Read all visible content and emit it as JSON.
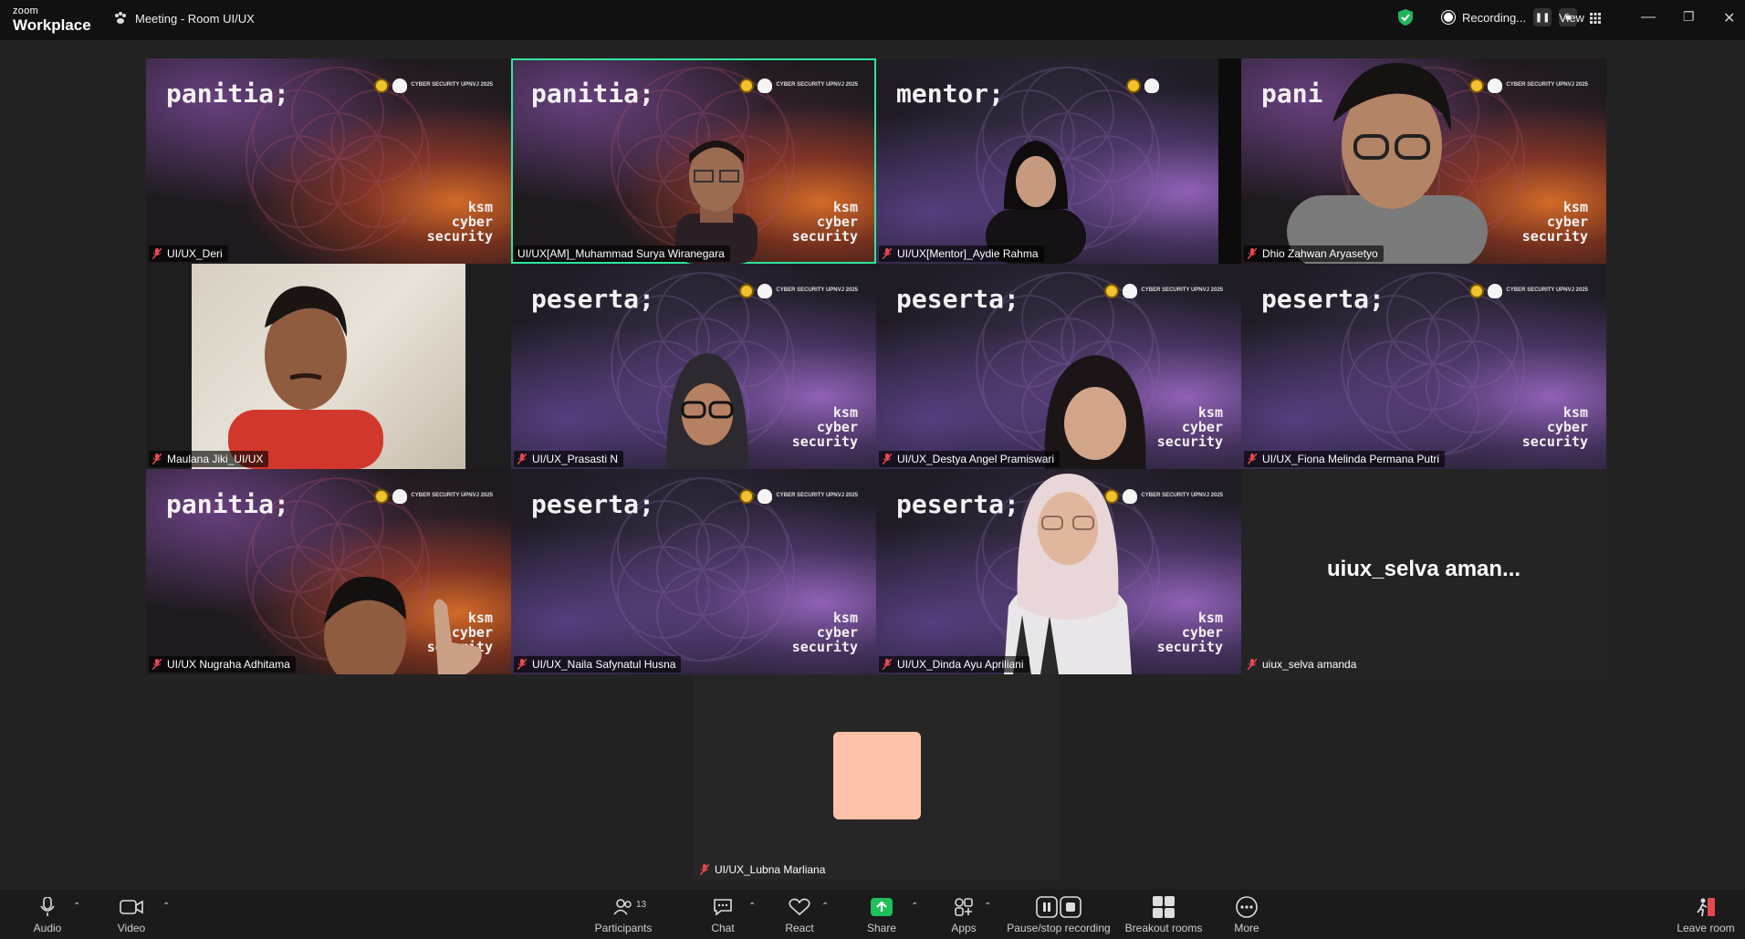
{
  "titlebar": {
    "brand_small": "zoom",
    "brand_big": "Workplace",
    "meeting_title": "Meeting - Room UI/UX",
    "recording_label": "Recording...",
    "view_label": "View"
  },
  "tile_badge_text": "CYBER SECURITY UPNVJ 2025",
  "tile_tagline": [
    "ksm",
    "cyber",
    "security"
  ],
  "tiles": [
    {
      "role": "panitia;",
      "name": "UI/UX_Deri"
    },
    {
      "role": "panitia;",
      "name": "UI/UX[AM]_Muhammad Surya Wiranegara"
    },
    {
      "role": "mentor;",
      "name": "UI/UX[Mentor]_Aydie Rahma"
    },
    {
      "role": "pani",
      "name": "Dhio Zahwan Aryasetyo"
    },
    {
      "role": "",
      "name": "Maulana Jiki_UI/UX"
    },
    {
      "role": "peserta;",
      "name": "UI/UX_Prasasti N"
    },
    {
      "role": "peserta;",
      "name": "UI/UX_Destya Angel Pramiswari"
    },
    {
      "role": "peserta;",
      "name": "UI/UX_Fiona Melinda Permana Putri"
    },
    {
      "role": "panitia;",
      "name": "UI/UX Nugraha Adhitama"
    },
    {
      "role": "peserta;",
      "name": "UI/UX_Naila Safynatul Husna"
    },
    {
      "role": "peserta;",
      "name": "UI/UX_Dinda Ayu Apriliani"
    },
    {
      "role": "",
      "name": "uiux_selva amanda",
      "display_name": "uiux_selva aman..."
    }
  ],
  "single_tile": {
    "name": "UI/UX_Lubna Marliana"
  },
  "toolbar": {
    "audio": "Audio",
    "video": "Video",
    "participants": "Participants",
    "participants_count": "13",
    "chat": "Chat",
    "react": "React",
    "share": "Share",
    "apps": "Apps",
    "pause_recording": "Pause/stop recording",
    "breakout": "Breakout rooms",
    "more": "More",
    "leave": "Leave room"
  },
  "colors": {
    "active_speaker": "#2ee59d",
    "share_green": "#1fbf5b",
    "avatar_fill": "#fec1a9",
    "muted_red": "#e5484d"
  }
}
